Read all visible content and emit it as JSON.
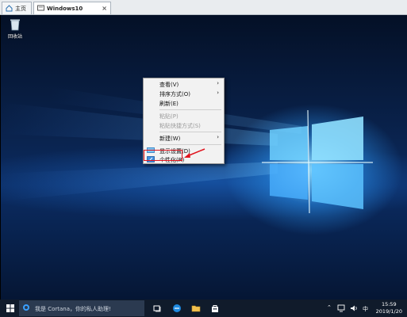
{
  "tabs": [
    {
      "label": "主页",
      "icon": "home-icon"
    },
    {
      "label": "Windows10",
      "icon": "vm-icon"
    }
  ],
  "desktop": {
    "recycle_bin_label": "回收站"
  },
  "context_menu": {
    "items": [
      {
        "label": "查看(V)",
        "submenu": true,
        "disabled": false
      },
      {
        "label": "排序方式(O)",
        "submenu": true,
        "disabled": false
      },
      {
        "label": "刷新(E)",
        "submenu": false,
        "disabled": false
      },
      {
        "label": "粘贴(P)",
        "submenu": false,
        "disabled": true
      },
      {
        "label": "粘贴快捷方式(S)",
        "submenu": false,
        "disabled": true
      },
      {
        "label": "新建(W)",
        "submenu": true,
        "disabled": false
      },
      {
        "label": "显示设置(D)",
        "submenu": false,
        "disabled": false,
        "icon": "display-icon"
      },
      {
        "label": "个性化(R)",
        "submenu": false,
        "disabled": false,
        "icon": "personalize-icon",
        "highlighted": true
      }
    ],
    "highlight_color": "#e0141e"
  },
  "taskbar": {
    "search_text": "我是 Cortana，你的私人助理!",
    "pinned": [
      "task-view-icon",
      "edge-icon",
      "file-explorer-icon",
      "store-icon"
    ],
    "tray": [
      "up-chevron-icon",
      "network-icon",
      "volume-icon",
      "ime-indicator"
    ],
    "ime_label": "中",
    "time": "15:59",
    "date": "2019/1/20"
  },
  "colors": {
    "accent": "#3aa0ff",
    "taskbar": "#101b2b"
  }
}
